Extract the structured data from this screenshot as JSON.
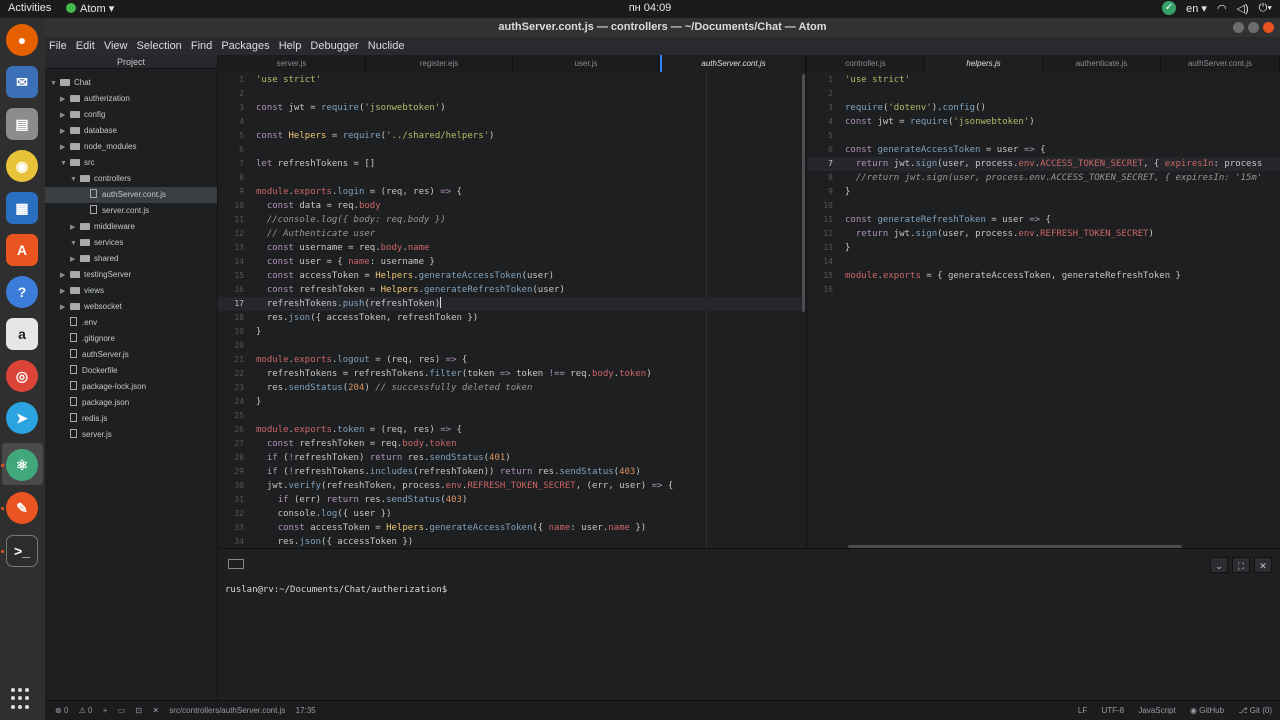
{
  "system": {
    "activities": "Activities",
    "app_name": "Atom",
    "clock": "пн 04:09",
    "lang": "en"
  },
  "window": {
    "title": "authServer.cont.js — controllers — ~/Documents/Chat — Atom"
  },
  "menu": [
    "File",
    "Edit",
    "View",
    "Selection",
    "Find",
    "Packages",
    "Help",
    "Debugger",
    "Nuclide"
  ],
  "tree": {
    "header": "Project",
    "items": [
      {
        "label": "Chat",
        "type": "folder",
        "open": true,
        "depth": 0
      },
      {
        "label": "autherization",
        "type": "folder",
        "open": false,
        "depth": 1
      },
      {
        "label": "config",
        "type": "folder",
        "open": false,
        "depth": 1
      },
      {
        "label": "database",
        "type": "folder",
        "open": false,
        "depth": 1
      },
      {
        "label": "node_modules",
        "type": "folder",
        "open": false,
        "depth": 1
      },
      {
        "label": "src",
        "type": "folder",
        "open": true,
        "depth": 1
      },
      {
        "label": "controllers",
        "type": "folder",
        "open": true,
        "depth": 2
      },
      {
        "label": "authServer.cont.js",
        "type": "file",
        "depth": 3,
        "selected": true
      },
      {
        "label": "server.cont.js",
        "type": "file",
        "depth": 3
      },
      {
        "label": "middleware",
        "type": "folder",
        "open": false,
        "depth": 2
      },
      {
        "label": "services",
        "type": "folder",
        "open": true,
        "depth": 2
      },
      {
        "label": "shared",
        "type": "folder",
        "open": false,
        "depth": 2
      },
      {
        "label": "testingServer",
        "type": "folder",
        "open": false,
        "depth": 1
      },
      {
        "label": "views",
        "type": "folder",
        "open": false,
        "depth": 1
      },
      {
        "label": "websocket",
        "type": "folder",
        "open": false,
        "depth": 1
      },
      {
        "label": ".env",
        "type": "file",
        "depth": 1
      },
      {
        "label": ".gitignore",
        "type": "file",
        "depth": 1
      },
      {
        "label": "authServer.js",
        "type": "file",
        "depth": 1
      },
      {
        "label": "Dockerfile",
        "type": "file",
        "depth": 1
      },
      {
        "label": "package-lock.json",
        "type": "file",
        "depth": 1
      },
      {
        "label": "package.json",
        "type": "file",
        "depth": 1
      },
      {
        "label": "redis.js",
        "type": "file",
        "depth": 1
      },
      {
        "label": "server.js",
        "type": "file",
        "depth": 1
      }
    ]
  },
  "left_tabs": [
    "server.js",
    "register.ejs",
    "user.js",
    "authServer.cont.js"
  ],
  "right_tabs": [
    "controller.js",
    "helpers.js",
    "authenticate.js",
    "authServer.cont.js"
  ],
  "left_code": [
    "<span class='s'>'use strict'</span>",
    "",
    "<span class='k'>const</span> jwt = <span class='f'>require</span>(<span class='s'>'jsonwebtoken'</span>)",
    "",
    "<span class='k'>const</span> <span class='cl'>Helpers</span> = <span class='f'>require</span>(<span class='s'>'../shared/helpers'</span>)",
    "",
    "<span class='k'>let</span> refreshTokens = []",
    "",
    "<span class='v'>module</span>.<span class='v'>exports</span>.<span class='f'>login</span> = (req, res) <span class='k'>=&gt;</span> {",
    "  <span class='k'>const</span> data = req.<span class='v'>body</span>",
    "  <span class='c'>//console.log({ body: req.body })</span>",
    "  <span class='c'>// Authenticate user</span>",
    "  <span class='k'>const</span> username = req.<span class='v'>body</span>.<span class='v'>name</span>",
    "  <span class='k'>const</span> user = { <span class='v'>name</span>: username }",
    "  <span class='k'>const</span> accessToken = <span class='cl'>Helpers</span>.<span class='f'>generateAccessToken</span>(user)",
    "  <span class='k'>const</span> refreshToken = <span class='cl'>Helpers</span>.<span class='f'>generateRefreshToken</span>(user)",
    "  refreshTokens.<span class='f'>push</span>(refreshToken)",
    "  res.<span class='f'>json</span>({ accessToken, refreshToken })",
    "}",
    "",
    "<span class='v'>module</span>.<span class='v'>exports</span>.<span class='f'>logout</span> = (req, res) <span class='k'>=&gt;</span> {",
    "  refreshTokens = refreshTokens.<span class='f'>filter</span>(token <span class='k'>=&gt;</span> token <span class='k'>!==</span> req.<span class='v'>body</span>.<span class='v'>token</span>)",
    "  res.<span class='f'>sendStatus</span>(<span class='n'>204</span>) <span class='c'>// successfully deleted token</span>",
    "}",
    "",
    "<span class='v'>module</span>.<span class='v'>exports</span>.<span class='f'>token</span> = (req, res) <span class='k'>=&gt;</span> {",
    "  <span class='k'>const</span> refreshToken = req.<span class='v'>body</span>.<span class='v'>token</span>",
    "  <span class='k'>if</span> (<span class='k'>!</span>refreshToken) <span class='k'>return</span> res.<span class='f'>sendStatus</span>(<span class='n'>401</span>)",
    "  <span class='k'>if</span> (<span class='k'>!</span>refreshTokens.<span class='f'>includes</span>(refreshToken)) <span class='k'>return</span> res.<span class='f'>sendStatus</span>(<span class='n'>403</span>)",
    "  jwt.<span class='f'>verify</span>(refreshToken, process.<span class='v'>env</span>.<span class='v'>REFRESH_TOKEN_SECRET</span>, (err, user) <span class='k'>=&gt;</span> {",
    "    <span class='k'>if</span> (err) <span class='k'>return</span> res.<span class='f'>sendStatus</span>(<span class='n'>403</span>)",
    "    console.<span class='f'>log</span>({ user })",
    "    <span class='k'>const</span> accessToken = <span class='cl'>Helpers</span>.<span class='f'>generateAccessToken</span>({ <span class='v'>name</span>: user.<span class='v'>name</span> })",
    "    res.<span class='f'>json</span>({ accessToken })"
  ],
  "right_code": [
    "<span class='s'>'use strict'</span>",
    "",
    "<span class='f'>require</span>(<span class='s'>'dotenv'</span>).<span class='f'>config</span>()",
    "<span class='k'>const</span> jwt = <span class='f'>require</span>(<span class='s'>'jsonwebtoken'</span>)",
    "",
    "<span class='k'>const</span> <span class='f'>generateAccessToken</span> = user <span class='k'>=&gt;</span> {",
    "  <span class='k'>return</span> jwt.<span class='f'>sign</span>(user, process.<span class='v'>env</span>.<span class='v'>ACCESS_TOKEN_SECRET</span>, { <span class='v'>expiresIn</span>: process",
    "  <span class='c'>//return jwt.sign(user, process.env.ACCESS_TOKEN_SECRET, { expiresIn: '15m'</span>",
    "}",
    "",
    "<span class='k'>const</span> <span class='f'>generateRefreshToken</span> = user <span class='k'>=&gt;</span> {",
    "  <span class='k'>return</span> jwt.<span class='f'>sign</span>(user, process.<span class='v'>env</span>.<span class='v'>REFRESH_TOKEN_SECRET</span>)",
    "}",
    "",
    "<span class='v'>module</span>.<span class='v'>exports</span> = { generateAccessToken, generateRefreshToken }",
    ""
  ],
  "left_cursor_line": 17,
  "right_cursor_line": 7,
  "terminal": {
    "prompt": "ruslan@rv:~/Documents/Chat/autherization$"
  },
  "status": {
    "errors": "0",
    "warnings": "0",
    "path": "src/controllers/authServer.cont.js",
    "cursor": "17:35",
    "eol": "LF",
    "encoding": "UTF-8",
    "grammar": "JavaScript",
    "github": "GitHub",
    "git": "Git (0)"
  }
}
